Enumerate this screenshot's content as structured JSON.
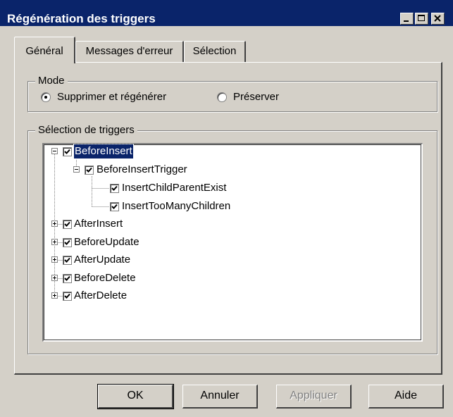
{
  "window": {
    "title": "Régénération des triggers"
  },
  "tabs": [
    {
      "label": "Général",
      "active": true
    },
    {
      "label": "Messages d'erreur",
      "active": false
    },
    {
      "label": "Sélection",
      "active": false
    }
  ],
  "mode_group": {
    "legend": "Mode",
    "options": [
      {
        "label": "Supprimer et régénérer",
        "selected": true
      },
      {
        "label": "Préserver",
        "selected": false
      }
    ]
  },
  "selection_group": {
    "legend": "Sélection de triggers",
    "tree": [
      {
        "label": "BeforeInsert",
        "checked": true,
        "expanded": true,
        "selected": true
      },
      {
        "label": "BeforeInsertTrigger",
        "checked": true,
        "expanded": true
      },
      {
        "label": "InsertChildParentExist",
        "checked": true
      },
      {
        "label": "InsertTooManyChildren",
        "checked": true
      },
      {
        "label": "AfterInsert",
        "checked": true,
        "expanded": false
      },
      {
        "label": "BeforeUpdate",
        "checked": true,
        "expanded": false
      },
      {
        "label": "AfterUpdate",
        "checked": true,
        "expanded": false
      },
      {
        "label": "BeforeDelete",
        "checked": true,
        "expanded": false
      },
      {
        "label": "AfterDelete",
        "checked": true,
        "expanded": false
      }
    ]
  },
  "buttons": {
    "ok": "OK",
    "cancel": "Annuler",
    "apply": "Appliquer",
    "help": "Aide"
  }
}
